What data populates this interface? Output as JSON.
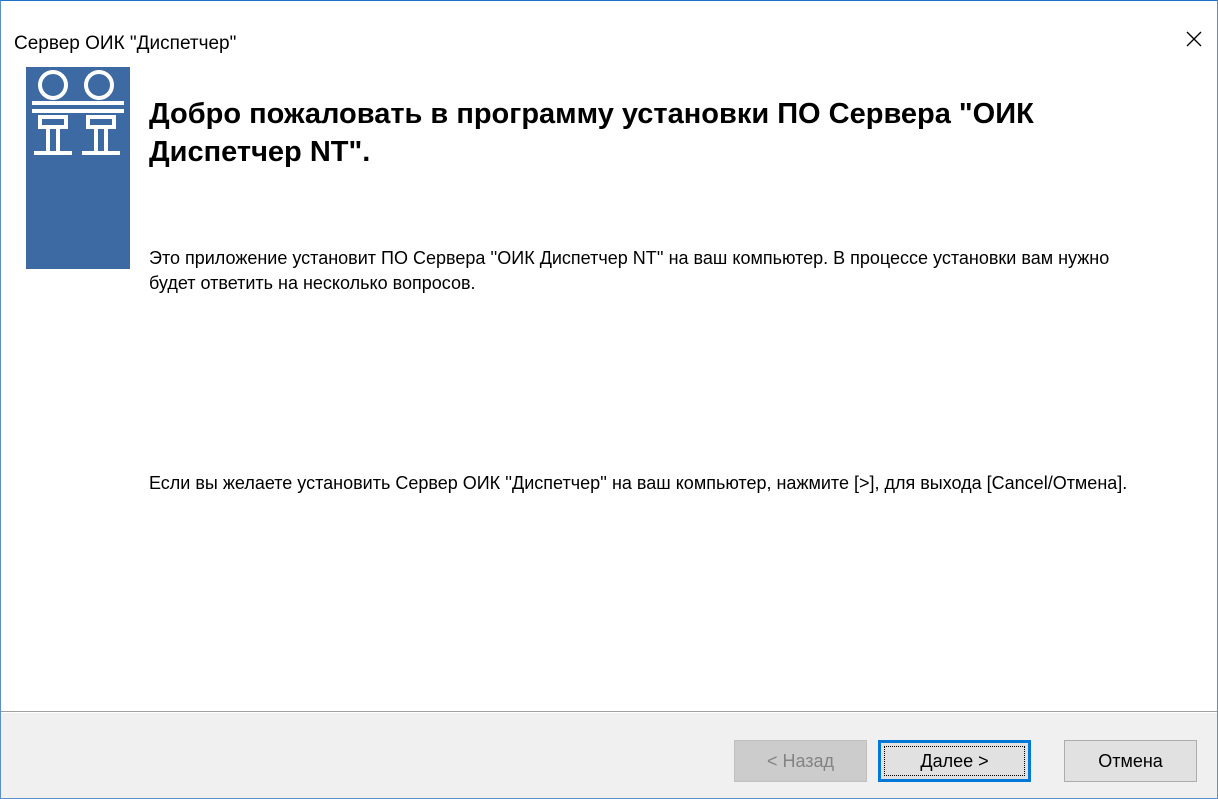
{
  "window": {
    "title": "Сервер ОИК \"Диспетчер\""
  },
  "icons": {
    "close": "close-icon",
    "logo": "oik-logo"
  },
  "colors": {
    "logo_background": "#3d6aa2",
    "footer_background": "#f0f0f0",
    "focus_border": "#0078d7"
  },
  "content": {
    "heading": "Добро пожаловать в программу установки ПО Сервера \"ОИК Диспетчер NT\".",
    "paragraph1": "Это приложение установит ПО Сервера ''ОИК Диспетчер NT'' на ваш компьютер. В процессе установки вам нужно будет ответить на несколько вопросов.",
    "paragraph2": "Если вы желаете установить Сервер ОИК ''Диспетчер'' на ваш компьютер, нажмите [>], для выхода [Cancel/Отмена]."
  },
  "buttons": {
    "back": "< Назад",
    "next": "Далее >",
    "cancel": "Отмена"
  }
}
